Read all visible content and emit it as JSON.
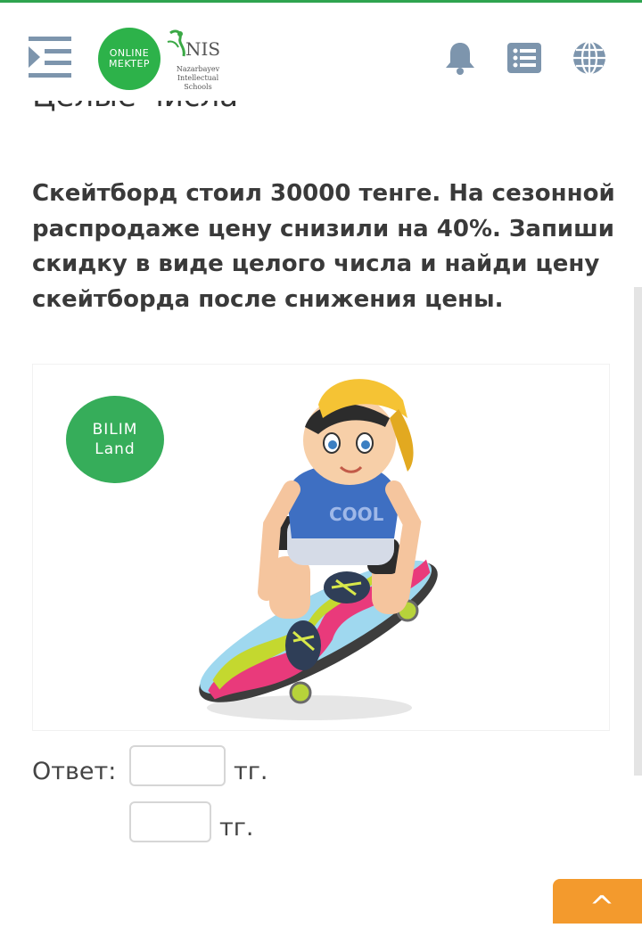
{
  "header": {
    "logo_online_line1": "ONLINE",
    "logo_online_line2": "MEKTEP",
    "logo_nis_title": "NIS",
    "logo_nis_sub1": "Nazarbayev",
    "logo_nis_sub2": "Intellectual",
    "logo_nis_sub3": "Schools",
    "icons": [
      "menu-expand-icon",
      "bell-icon",
      "list-icon",
      "globe-icon"
    ]
  },
  "section_title": "Целые числа",
  "question": "Скейтборд стоил 30000 тенге. На сезонной распродаже цену снизили на 40%. Запиши скидку в виде целого числа и найди цену скейтборда после снижения цены.",
  "illustration": {
    "badge_line1": "BILIM",
    "badge_line2": "Land",
    "shirt_text": "COOL"
  },
  "answer": {
    "label": "Ответ:",
    "fields": [
      {
        "value": "",
        "unit": "тг."
      },
      {
        "value": "",
        "unit": "тг."
      }
    ]
  },
  "scroll_up_label": "^",
  "colors": {
    "accent_green": "#2db24a",
    "orange": "#f39a2d",
    "icon_gray": "#7d95ad"
  }
}
